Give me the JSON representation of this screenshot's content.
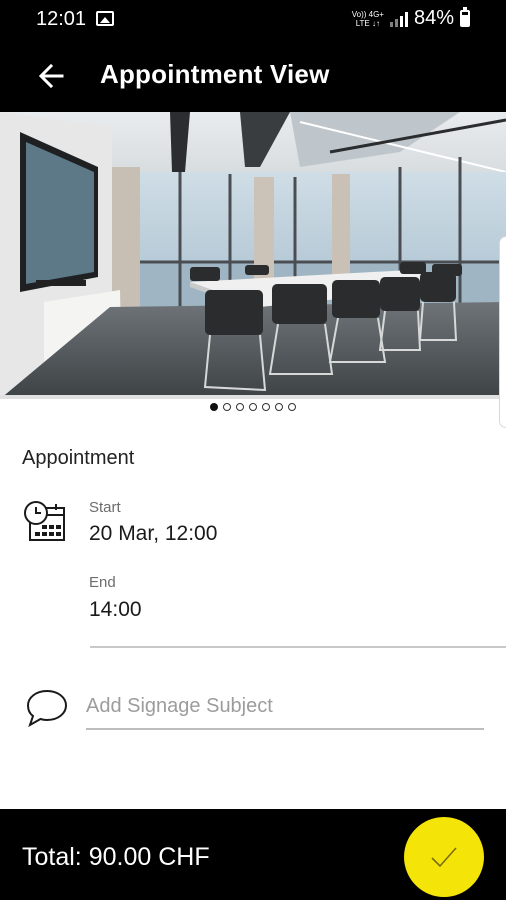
{
  "status_bar": {
    "time": "12:01",
    "net_top": "Vo)) 4G+",
    "net_bottom": "LTE ↓↑",
    "battery": "84%"
  },
  "app_bar": {
    "title": "Appointment View",
    "back_icon": "arrow-left-icon"
  },
  "gallery": {
    "image_description": "conference room photo",
    "pages": 7,
    "current_page": 1
  },
  "appointment": {
    "section_title": "Appointment",
    "start_label": "Start",
    "start_value": "20 Mar, 12:00",
    "end_label": "End",
    "end_value": "14:00",
    "calendar_icon": "calendar-clock-icon"
  },
  "signage": {
    "placeholder": "Add Signage Subject",
    "value": "",
    "icon": "chat-bubble-icon"
  },
  "footer": {
    "total": "Total: 90.00 CHF",
    "confirm_icon": "checkmark-icon",
    "confirm_color": "#F5E408"
  }
}
